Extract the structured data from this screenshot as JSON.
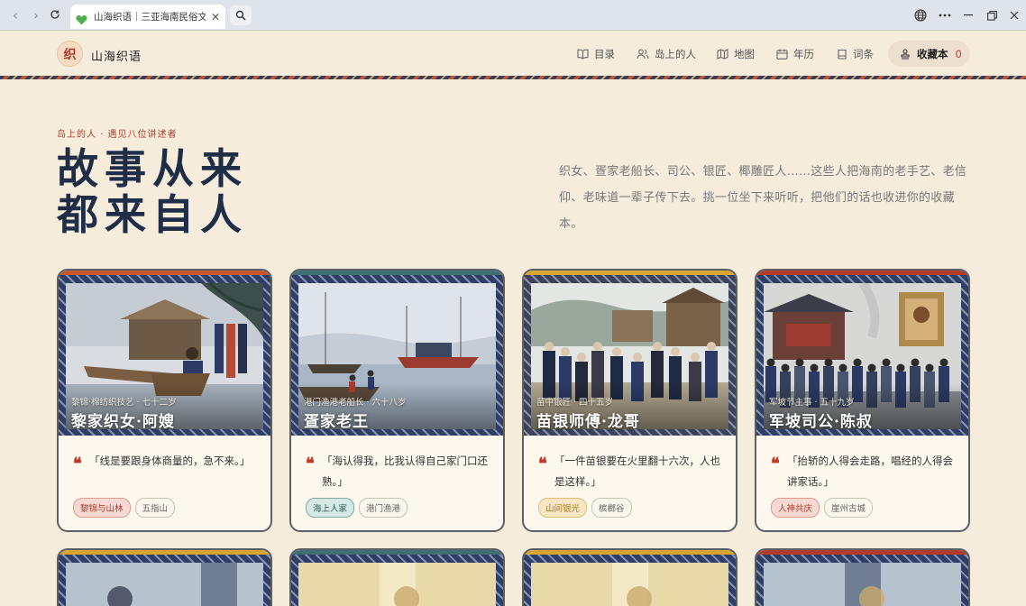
{
  "browser": {
    "tab_title": "山海织语｜三亚海南民俗文化"
  },
  "site": {
    "logo_char": "织",
    "name": "山海织语",
    "nav": [
      {
        "label": "目录",
        "icon": "book-open-icon"
      },
      {
        "label": "岛上的人",
        "icon": "people-icon"
      },
      {
        "label": "地图",
        "icon": "map-icon"
      },
      {
        "label": "年历",
        "icon": "calendar-icon"
      },
      {
        "label": "词条",
        "icon": "bookmark-book-icon"
      }
    ],
    "favorites": {
      "label": "收藏本",
      "count": "0",
      "icon": "stamp-icon"
    }
  },
  "hero": {
    "eyebrow": "岛上的人 · 遇见八位讲述者",
    "title_line1": "故事从来",
    "title_line2": "都来自人",
    "description": "织女、疍家老船长、司公、银匠、椰雕匠人……这些人把海南的老手艺、老信仰、老味道一辈子传下去。挑一位坐下来听听，把他们的话也收进你的收藏本。"
  },
  "cards": [
    {
      "meta": "黎锦·棉纺织技艺 · 七十二岁",
      "name": "黎家织女·阿嫂",
      "quote": "「线是要跟身体商量的，急不来。」",
      "tags": [
        {
          "label": "黎锦与山林",
          "style": "red"
        },
        {
          "label": "五指山",
          "style": "plain"
        }
      ],
      "accent": "#c4572f",
      "frame": "#2f3e66"
    },
    {
      "meta": "港门渔港老船长 · 六十八岁",
      "name": "疍家老王",
      "quote": "「海认得我，比我认得自己家门口还熟。」",
      "tags": [
        {
          "label": "海上人家",
          "style": "teal"
        },
        {
          "label": "港门渔港",
          "style": "plain"
        }
      ],
      "accent": "#3f6f73",
      "frame": "#2f3e66"
    },
    {
      "meta": "苗中银匠 · 四十五岁",
      "name": "苗银师傅·龙哥",
      "quote": "「一件苗银要在火里翻十六次，人也是这样。」",
      "tags": [
        {
          "label": "山间银光",
          "style": "gold"
        },
        {
          "label": "槟榔谷",
          "style": "plain"
        }
      ],
      "accent": "#d8a531",
      "frame": "#3c4358"
    },
    {
      "meta": "军坡节主事 · 五十九岁",
      "name": "军坡司公·陈叔",
      "quote": "「抬轿的人得会走路，唱经的人得会讲家话。」",
      "tags": [
        {
          "label": "人神共庆",
          "style": "red"
        },
        {
          "label": "崖州古城",
          "style": "plain"
        }
      ],
      "accent": "#b23b2c",
      "frame": "#2f3e66"
    }
  ],
  "more_cards": [
    {
      "accent": "#d8a531"
    },
    {
      "accent": "#3f6f73"
    },
    {
      "accent": "#d8a531"
    },
    {
      "accent": "#b23b2c"
    }
  ]
}
